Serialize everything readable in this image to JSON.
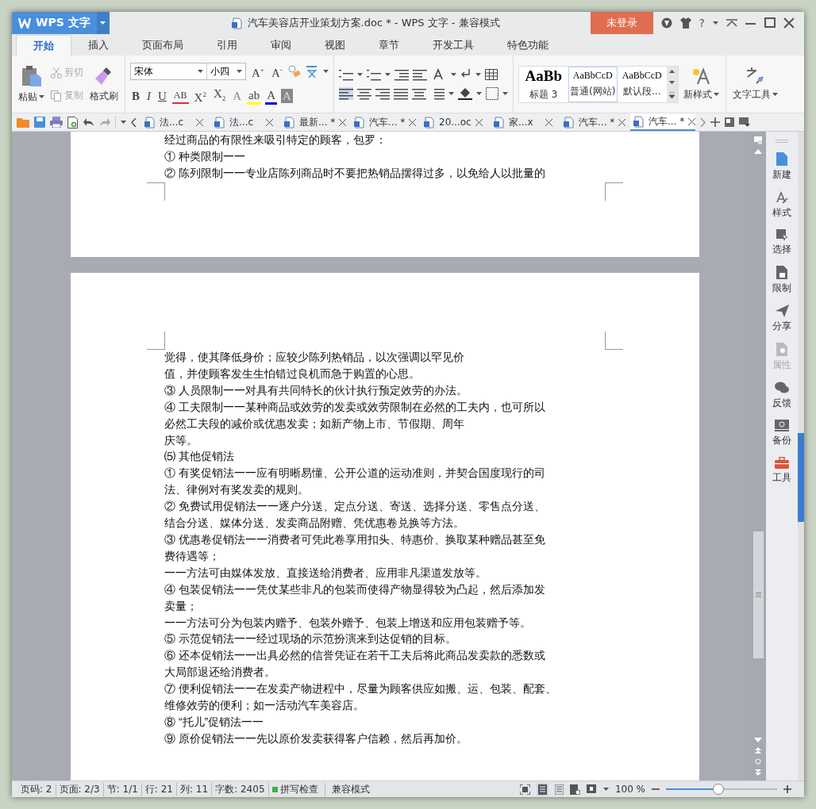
{
  "title_bar": {
    "app_menu": "WPS 文字",
    "document_title": "汽车美容店开业策划方案.doc * - WPS 文字 - 兼容模式",
    "login": "未登录",
    "help": "?"
  },
  "menu_tabs": [
    {
      "label": "开始",
      "selected": true
    },
    {
      "label": "插入",
      "selected": false
    },
    {
      "label": "页面布局",
      "selected": false
    },
    {
      "label": "引用",
      "selected": false
    },
    {
      "label": "审阅",
      "selected": false
    },
    {
      "label": "视图",
      "selected": false
    },
    {
      "label": "章节",
      "selected": false
    },
    {
      "label": "开发工具",
      "selected": false
    },
    {
      "label": "特色功能",
      "selected": false
    }
  ],
  "ribbon": {
    "paste": "粘贴",
    "cut": {
      "label": "剪切",
      "disabled": true
    },
    "copy": {
      "label": "复制",
      "disabled": true
    },
    "format_painter": "格式刷",
    "font_name": "宋体",
    "font_size": "小四",
    "size_buttons": [
      "A$^{+}$",
      "A$^{-}$"
    ],
    "format_buttons": [
      {
        "kind": "bold",
        "label": "B"
      },
      {
        "kind": "italic",
        "label": "I"
      },
      {
        "kind": "underline",
        "label": "U"
      },
      {
        "kind": "strike",
        "label": "AB"
      },
      {
        "kind": "plain",
        "label": "X$^{2}$"
      },
      {
        "kind": "plain",
        "label": "X$_{2}$"
      },
      {
        "kind": "effect",
        "label": "A"
      },
      {
        "kind": "highlight",
        "label": "ab"
      },
      {
        "kind": "color",
        "label": "A"
      },
      {
        "kind": "shade",
        "label": "A"
      }
    ],
    "styles": [
      {
        "preview": "AaBb",
        "label": "标题 3",
        "kind": "heading",
        "selected": false
      },
      {
        "preview": "AaBbCcD",
        "label": "普通(网站)",
        "kind": "normal",
        "selected": true
      },
      {
        "preview": "AaBbCcD",
        "label": "默认段...",
        "kind": "normal",
        "selected": false
      }
    ],
    "new_style": "新样式",
    "text_tools": "文字工具"
  },
  "doc_tabs": [
    {
      "label": "法...c",
      "selected": false
    },
    {
      "label": "法...c",
      "selected": false
    },
    {
      "label": "最新... *",
      "selected": false
    },
    {
      "label": "汽车... *",
      "selected": false
    },
    {
      "label": "20...oc",
      "selected": false
    },
    {
      "label": "家...x",
      "selected": false
    },
    {
      "label": "汽车... *",
      "selected": false
    },
    {
      "label": "汽车... *",
      "selected": true
    }
  ],
  "pages": [
    {
      "lines": [
        "经过商品的有限性来吸引特定的顾客，包罗：",
        "① 种类限制一一",
        "② 陈列限制一一专业店陈列商品时不要把热销品摆得过多，以免给人以批量的"
      ]
    },
    {
      "lines": [
        "觉得，使其降低身价；应较少陈列热销品，以次强调以罕见价",
        "值，并使顾客发生生怕错过良机而急于购置的心思。",
        "③ 人员限制一一对具有共同特长的伙计执行预定效劳的办法。",
        "④ 工夫限制一一某种商品或效劳的发卖或效劳限制在必然的工夫内，也可所以",
        "必然工夫段的减价或优惠发卖；如新产物上市、节假期、周年",
        "庆等。",
        "⑸ 其他促销法",
        "① 有奖促销法一一应有明晰易懂、公开公道的运动准则，并契合国度现行的司",
        "法、律例对有奖发卖的规则。",
        "② 免费试用促销法一一逐户分送、定点分送、寄送、选择分送、零售点分送、",
        "结合分送、媒体分送、发卖商品附赠、凭优惠卷兑换等方法。",
        "③ 优惠卷促销法一一消费者可凭此卷享用扣头、特惠价、换取某种赠品甚至免",
        "费待遇等；",
        "一一方法可由媒体发放、直接送给消费者、应用非凡渠道发放等。",
        "④ 包装促销法一一凭仗某些非凡的包装而使得产物显得较为凸起，然后添加发",
        "卖量；",
        "一一方法可分为包装内赠予、包装外赠予、包装上增送和应用包装赠予等。",
        "⑤ 示范促销法一一经过现场的示范扮演来到达促销的目标。",
        "⑥ 还本促销法一一出具必然的信誉凭证在若干工夫后将此商品发卖款的悉数或",
        "大局部退还给消费者。",
        "⑦ 便利促销法一一在发卖产物进程中，尽量为顾客供应如搬、运、包装、配套、",
        "维修效劳的便利；如一活动汽车美容店。",
        "⑧ “托儿”促销法一一",
        "⑨ 原价促销法一一先以原价发卖获得客户信赖，然后再加价。"
      ]
    }
  ],
  "sidebar": [
    {
      "kind": "new",
      "label": "新建",
      "disabled": false
    },
    {
      "kind": "style",
      "label": "样式",
      "disabled": false
    },
    {
      "kind": "select",
      "label": "选择",
      "disabled": false
    },
    {
      "kind": "restrict",
      "label": "限制",
      "disabled": false
    },
    {
      "kind": "share",
      "label": "分享",
      "disabled": false
    },
    {
      "kind": "properties",
      "label": "属性",
      "disabled": true
    },
    {
      "kind": "feedback",
      "label": "反馈",
      "disabled": false
    },
    {
      "kind": "backup",
      "label": "备份",
      "disabled": false
    },
    {
      "kind": "tools",
      "label": "工具",
      "disabled": false
    }
  ],
  "status_bar": {
    "items": [
      "页码: 2",
      "页面: 2/3",
      "节: 1/1",
      "行: 21",
      "列: 11",
      "字数: 2405"
    ],
    "spell_check": "拼写检查",
    "mode": "兼容模式",
    "zoom": "100 %",
    "zoom_slider": {
      "level": 0.47
    }
  }
}
